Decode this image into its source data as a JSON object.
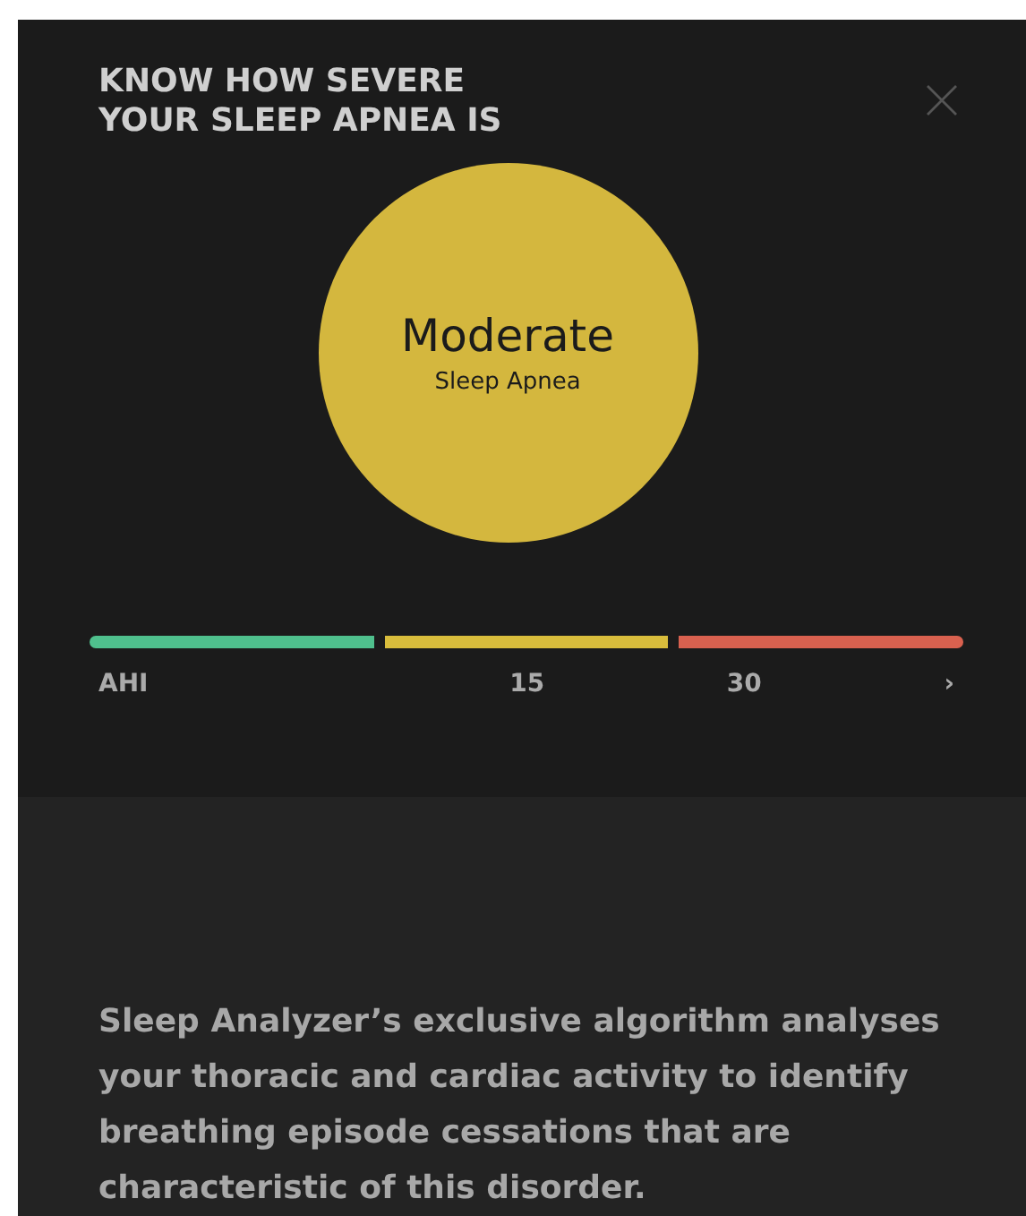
{
  "title": "KNOW HOW SEVERE\nYOUR SLEEP APNEA IS",
  "result": {
    "severity": "Moderate",
    "condition": "Sleep Apnea"
  },
  "scale": {
    "segments": [
      {
        "color": "#4fc08d"
      },
      {
        "color": "#d9bd3c"
      },
      {
        "color": "#d9614f"
      }
    ],
    "labels": [
      "AHI",
      "15",
      "30",
      "›"
    ]
  },
  "description": "Sleep Analyzer’s exclusive algorithm analyses your thoracic and cardiac activity to identify breathing episode cessations that are characteristic of this disorder."
}
